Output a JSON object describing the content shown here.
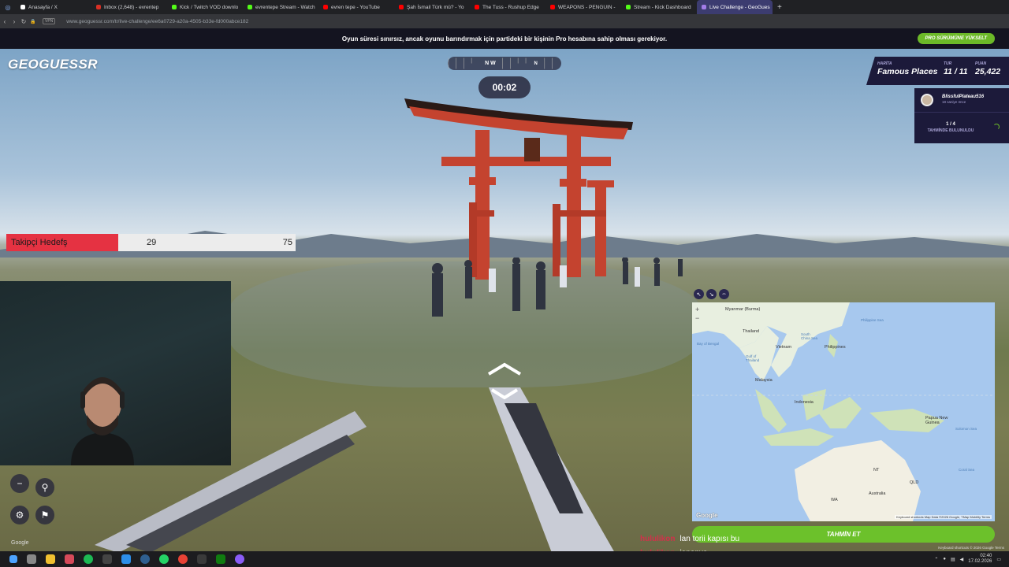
{
  "browser": {
    "tabs": [
      {
        "label": "Anasayfa / X",
        "color": "#ffffff"
      },
      {
        "label": "Inbox (2,648) - evrentep",
        "color": "#d93025"
      },
      {
        "label": "Kick / Twitch VOD downlo",
        "color": "#53fc18"
      },
      {
        "label": "evrentepe Stream - Watch",
        "color": "#53fc18"
      },
      {
        "label": "evren tepe - YouTube",
        "color": "#ff0000"
      },
      {
        "label": "Şah İsmail Türk mü? - Yo",
        "color": "#ff0000"
      },
      {
        "label": "The Tuss - Rushup Edge",
        "color": "#ff0000"
      },
      {
        "label": "WEAPONS - PENGUIN - ",
        "color": "#ff0000"
      },
      {
        "label": "Stream - Kick Dashboard",
        "color": "#53fc18"
      },
      {
        "label": "Live Challenge - GeoGues",
        "color": "#a27ce8",
        "active": true
      }
    ],
    "url": "www.geoguessr.com/tr/live-challenge/ee6a0729-a20a-4505-b33e-fd000abce182",
    "new_tab": "+"
  },
  "banner": {
    "text": "Oyun süresi sınırsız, ancak oyunu barındırmak için partideki bir kişinin Pro hesabına sahip olması gerekiyor.",
    "pro_button": "PRO SÜRÜMÜNE YÜKSELT"
  },
  "game": {
    "logo": "GEOGUESSR",
    "compass": {
      "ticks_left": "| | | | | | |",
      "heading": "NW",
      "ticks_mid": "| | | | | |",
      "marker": "N",
      "ticks_right": "| | | |"
    },
    "timer": "00:02",
    "status": {
      "map_label": "HARİTA",
      "map_value": "Famous Places",
      "round_label": "TUR",
      "round_value": "11 / 11",
      "score_label": "PUAN",
      "score_value": "25,422"
    },
    "player": {
      "name": "BlissfulPlateau516",
      "sub": "18 saniye önce",
      "count": "1 / 4",
      "found_label": "TAHMİNDE BULUNULDU"
    },
    "goal": {
      "label": "Takipçi Hedefş",
      "current": "29",
      "target": "75",
      "progress": 0.387
    },
    "map_labels": {
      "myanmar": "Myanmar (Burma)",
      "thailand": "Thailand",
      "vietnam": "Vietnam",
      "philippines": "Philippines",
      "malaysia": "Malaysia",
      "indonesia": "Indonesia",
      "png": "Papua New Guinea",
      "australia": "Australia",
      "philippine_sea": "Philippine Sea",
      "south_china_sea": "South China Sea",
      "bay": "Bay of Bengal",
      "gulf": "Gulf of Thailand",
      "solomon": "Solomon Sea",
      "coral": "Coral Sea",
      "nt": "NT",
      "qld": "QLD",
      "wa": "WA",
      "google": "Google",
      "terms": "Keyboard shortcuts   Map Data ©2026 Google, TMap Mobility   Terms",
      "zoom_in": "+",
      "zoom_out": "−"
    },
    "guess_button": "TAHMİN ET",
    "sv_google": "Google",
    "shortcuts": "Keyboard shortcuts  © 2026 Google  Terms"
  },
  "chat": [
    {
      "user": "hululikon",
      "message": "lan torii kapısı bu"
    },
    {
      "user": "hululikon",
      "message": "japonya"
    }
  ],
  "taskbar": {
    "time": "02:40",
    "date": "17.02.2026"
  }
}
